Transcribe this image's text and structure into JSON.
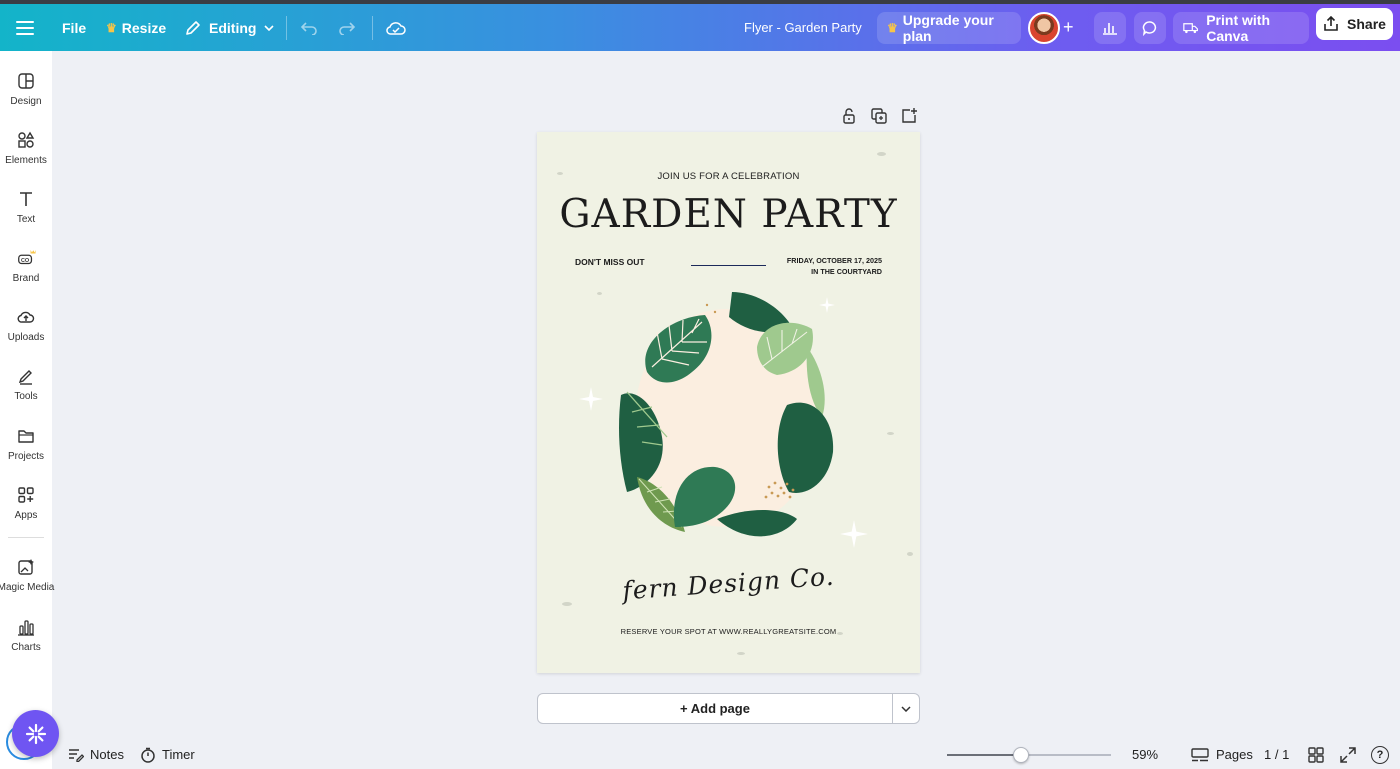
{
  "app": {
    "document_title": "Flyer - Garden Party",
    "brand_colors": {
      "accent_start": "#13b4c9",
      "accent_end": "#7b4ef0",
      "crown": "#f7c548",
      "assistant": "#6f55f2"
    }
  },
  "topbar": {
    "menu_icon": "hamburger-icon",
    "file_label": "File",
    "resize_label": "Resize",
    "editing_label": "Editing",
    "upgrade_label": "Upgrade your plan",
    "print_label": "Print with Canva",
    "share_label": "Share"
  },
  "sidebar": {
    "items": [
      {
        "label": "Design",
        "icon": "layout-icon"
      },
      {
        "label": "Elements",
        "icon": "shapes-icon"
      },
      {
        "label": "Text",
        "icon": "text-icon"
      },
      {
        "label": "Brand",
        "icon": "brand-icon"
      },
      {
        "label": "Uploads",
        "icon": "cloud-upload-icon"
      },
      {
        "label": "Tools",
        "icon": "pen-icon"
      },
      {
        "label": "Projects",
        "icon": "folder-icon"
      },
      {
        "label": "Apps",
        "icon": "apps-icon"
      },
      {
        "label": "Magic Media",
        "icon": "magic-media-icon"
      },
      {
        "label": "Charts",
        "icon": "chart-icon"
      }
    ]
  },
  "flyer": {
    "kicker": "JOIN US FOR A CELEBRATION",
    "title": "GARDEN PARTY",
    "left_note": "DON'T MISS OUT",
    "date": "FRIDAY, OCTOBER 17, 2025",
    "location": "IN THE COURTYARD",
    "signature": "fern Design Co.",
    "footer": "RESERVE YOUR SPOT AT WWW.REALLYGREATSITE.COM",
    "colors": {
      "background": "#f0f2e4",
      "dark_leaf": "#1f5f42",
      "mid_leaf": "#2f7a55",
      "light_leaf": "#9fc98e",
      "blush": "#fbeee0"
    }
  },
  "canvas_controls": {
    "add_page_label": "+ Add page"
  },
  "bottombar": {
    "notes_label": "Notes",
    "timer_label": "Timer",
    "zoom_value": "59%",
    "zoom_fraction": 0.45,
    "pages_label": "Pages",
    "page_counter": "1 / 1",
    "help_label": "?"
  }
}
